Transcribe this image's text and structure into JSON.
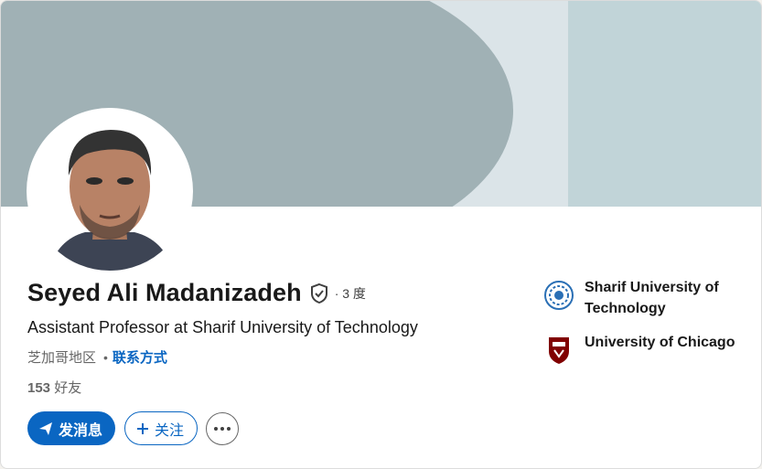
{
  "profile": {
    "name": "Seyed Ali Madanizadeh",
    "degree": "· 3 度",
    "headline": "Assistant Professor at Sharif University of Technology",
    "location": "芝加哥地区",
    "separator": "•",
    "contact_label": "联系方式",
    "connections_count": "153",
    "connections_label": "好友"
  },
  "actions": {
    "message_label": "发消息",
    "follow_label": "关注"
  },
  "organizations": [
    {
      "name": "Sharif University of Technology",
      "logo": "sharif-logo-icon"
    },
    {
      "name": "University of Chicago",
      "logo": "uchicago-logo-icon"
    }
  ],
  "colors": {
    "accent": "#0a66c2",
    "banner_dark": "#a0b1b5",
    "banner_light": "#dbe4e8"
  }
}
